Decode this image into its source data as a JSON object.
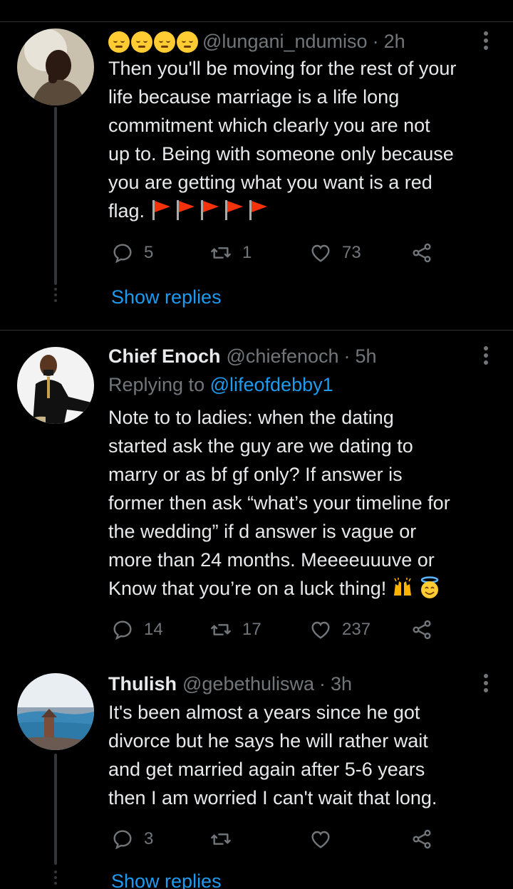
{
  "tweets": [
    {
      "emoji_prefix": "pensive-face x4",
      "name": "",
      "handle": "@lungani_ndumiso",
      "separator": "·",
      "time": "2h",
      "body": "Then you'll be moving for the rest of your life because marriage is a life long commitment which clearly you are not up to. Being with someone only because you are getting what you want is a red flag.",
      "body_lines": [
        "Then you'll be moving for the rest of your",
        "life because marriage is a life long",
        "commitment which clearly you are not",
        "up to. Being with someone only because",
        "you are getting what you want is a red",
        "flag."
      ],
      "trailing_emoji": "red-flag x5",
      "replies": "5",
      "retweets": "1",
      "likes": "73",
      "show_replies": "Show replies"
    },
    {
      "name": "Chief Enoch",
      "handle": "@chiefenoch",
      "separator": "·",
      "time": "5h",
      "replying_prefix": "Replying to ",
      "replying_to": "@lifeofdebby1",
      "body_lines": [
        "Note to to ladies: when the dating",
        "started ask the guy are we dating to",
        "marry or as bf gf only? If answer is",
        "former then ask “what’s your timeline for",
        "the wedding” if d answer is vague or",
        "more than 24 months. Meeeeuuuve or",
        "Know that you’re on a luck thing!"
      ],
      "trailing_emoji": "raising-hands, smiling-face-with-halo",
      "replies": "14",
      "retweets": "17",
      "likes": "237"
    },
    {
      "name": "Thulish",
      "handle": "@gebethuliswa",
      "separator": "·",
      "time": "3h",
      "body_lines": [
        "It's been almost a years since he got",
        "divorce but he says he will rather wait",
        "and get married again after 5-6 years",
        "then I am worried I can't wait that long."
      ],
      "replies": "3",
      "retweets": "",
      "likes": "",
      "show_replies": "Show replies"
    }
  ],
  "colors": {
    "background": "#000000",
    "text": "#e7e9ea",
    "muted": "#71767b",
    "link": "#1d9bf0",
    "divider": "#2f3336"
  },
  "icons": [
    "reply-icon",
    "retweet-icon",
    "like-icon",
    "share-icon",
    "more-icon",
    "red-flag-emoji",
    "pensive-face-emoji",
    "raising-hands-emoji",
    "halo-face-emoji"
  ]
}
